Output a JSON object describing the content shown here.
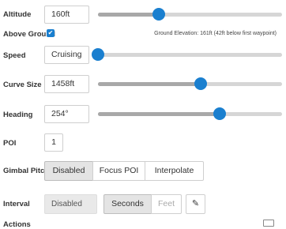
{
  "altitude": {
    "label": "Altitude",
    "value": "160ft",
    "slider_level": 0.33
  },
  "above_ground": {
    "label": "Above Ground",
    "checked": true,
    "note": "Ground Elevation: 161ft (42ft below first waypoint)"
  },
  "speed": {
    "label": "Speed",
    "value": "Cruising",
    "slider_level": 0.0
  },
  "curve_size": {
    "label": "Curve Size",
    "value": "1458ft",
    "slider_level": 0.56
  },
  "heading": {
    "label": "Heading",
    "value": "254°",
    "slider_level": 0.66
  },
  "poi": {
    "label": "POI",
    "value": "1"
  },
  "gimbal_pitch": {
    "label": "Gimbal Pitch",
    "options": [
      "Disabled",
      "Focus POI",
      "Interpolate"
    ],
    "selected": "Disabled"
  },
  "interval": {
    "label": "Interval",
    "value": "Disabled",
    "units": [
      "Seconds",
      "Feet"
    ],
    "selected_unit": "Seconds"
  },
  "actions": {
    "label": "Actions"
  },
  "icons": {
    "edit": "pencil-icon",
    "checkbox": "check-icon",
    "actions": "card-icon"
  },
  "colors": {
    "accent": "#1a7fcf",
    "track": "#d6d6d6",
    "fill": "#a8a8a8"
  }
}
